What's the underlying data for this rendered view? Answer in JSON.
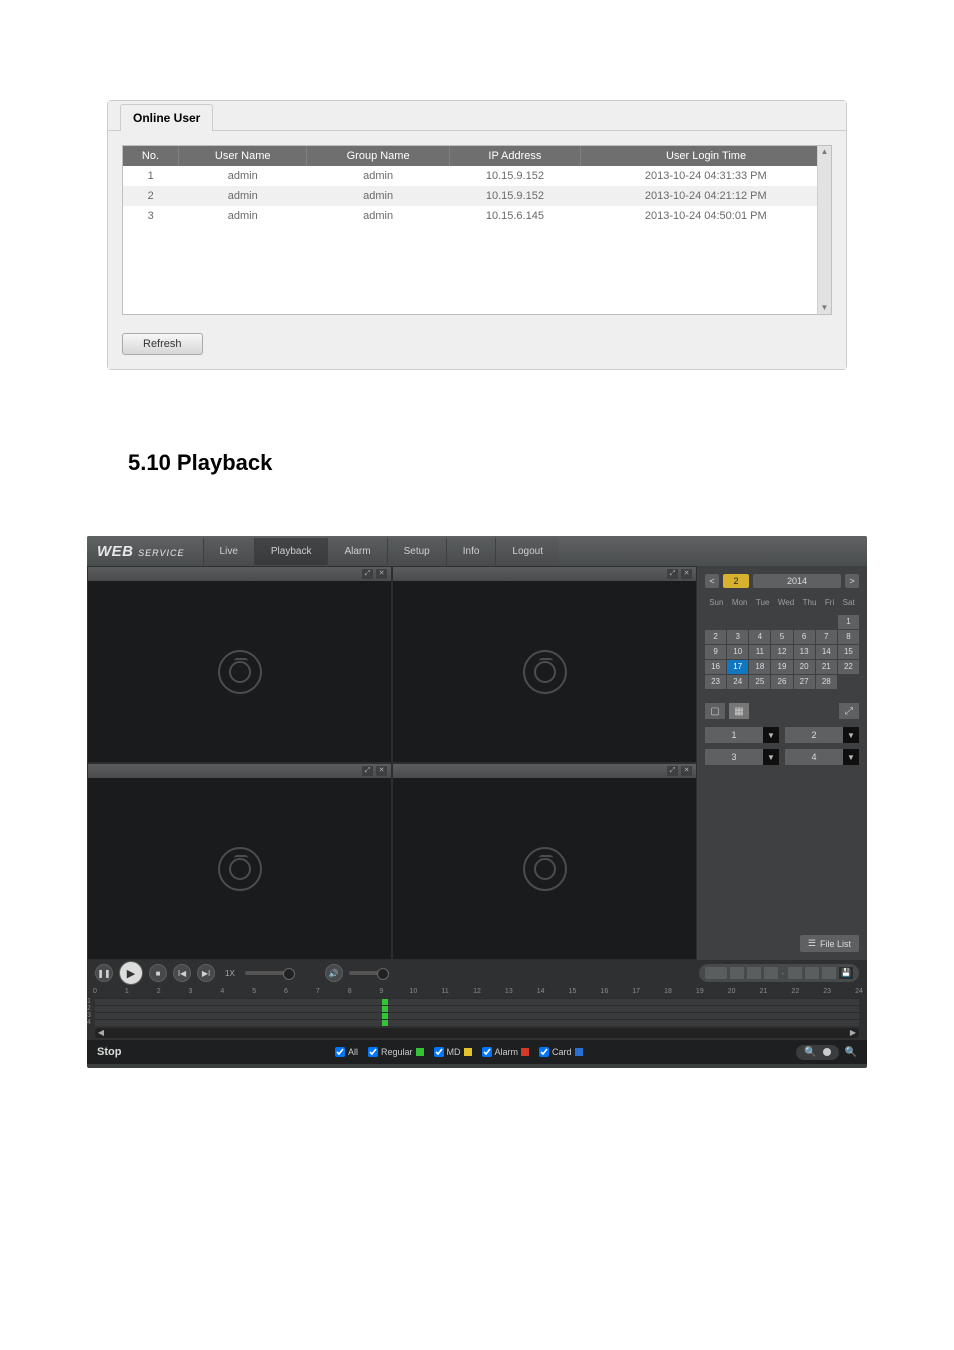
{
  "online_user": {
    "tab_label": "Online User",
    "columns": [
      "No.",
      "User Name",
      "Group Name",
      "IP Address",
      "User Login Time"
    ],
    "rows": [
      {
        "no": "1",
        "user": "admin",
        "group": "admin",
        "ip": "10.15.9.152",
        "time": "2013-10-24 04:31:33 PM"
      },
      {
        "no": "2",
        "user": "admin",
        "group": "admin",
        "ip": "10.15.9.152",
        "time": "2013-10-24 04:21:12 PM"
      },
      {
        "no": "3",
        "user": "admin",
        "group": "admin",
        "ip": "10.15.6.145",
        "time": "2013-10-24 04:50:01 PM"
      }
    ],
    "refresh_label": "Refresh"
  },
  "section_heading": "5.10  Playback",
  "playback": {
    "logo_main": "WEB",
    "logo_sub": "SERVICE",
    "nav": [
      "Live",
      "Playback",
      "Alarm",
      "Setup",
      "Info",
      "Logout"
    ],
    "nav_active_index": 1,
    "calendar": {
      "month": "2",
      "year": "2014",
      "dow": [
        "Sun",
        "Mon",
        "Tue",
        "Wed",
        "Thu",
        "Fri",
        "Sat"
      ],
      "leading_blanks": 6,
      "days": 28,
      "active_day": 17
    },
    "channels": [
      "1",
      "2",
      "3",
      "4"
    ],
    "file_list_label": "File List",
    "speed_label": "1X",
    "timeline_hours": [
      "0",
      "1",
      "2",
      "3",
      "4",
      "5",
      "6",
      "7",
      "8",
      "9",
      "10",
      "11",
      "12",
      "13",
      "14",
      "15",
      "16",
      "17",
      "18",
      "19",
      "20",
      "21",
      "22",
      "23",
      "24"
    ],
    "timeline_row_labels": [
      "1",
      "2",
      "3",
      "4"
    ],
    "timeline_marks": {
      "row": 0,
      "left_pct": 37.5,
      "width_pct": 0.8
    },
    "status_left": "Stop",
    "legend": [
      {
        "label": "All",
        "color": null,
        "checked": true
      },
      {
        "label": "Regular",
        "color": "#34c334",
        "checked": true
      },
      {
        "label": "MD",
        "color": "#e3c32a",
        "checked": true
      },
      {
        "label": "Alarm",
        "color": "#d23a2a",
        "checked": true
      },
      {
        "label": "Card",
        "color": "#2a6fd2",
        "checked": true
      }
    ]
  }
}
